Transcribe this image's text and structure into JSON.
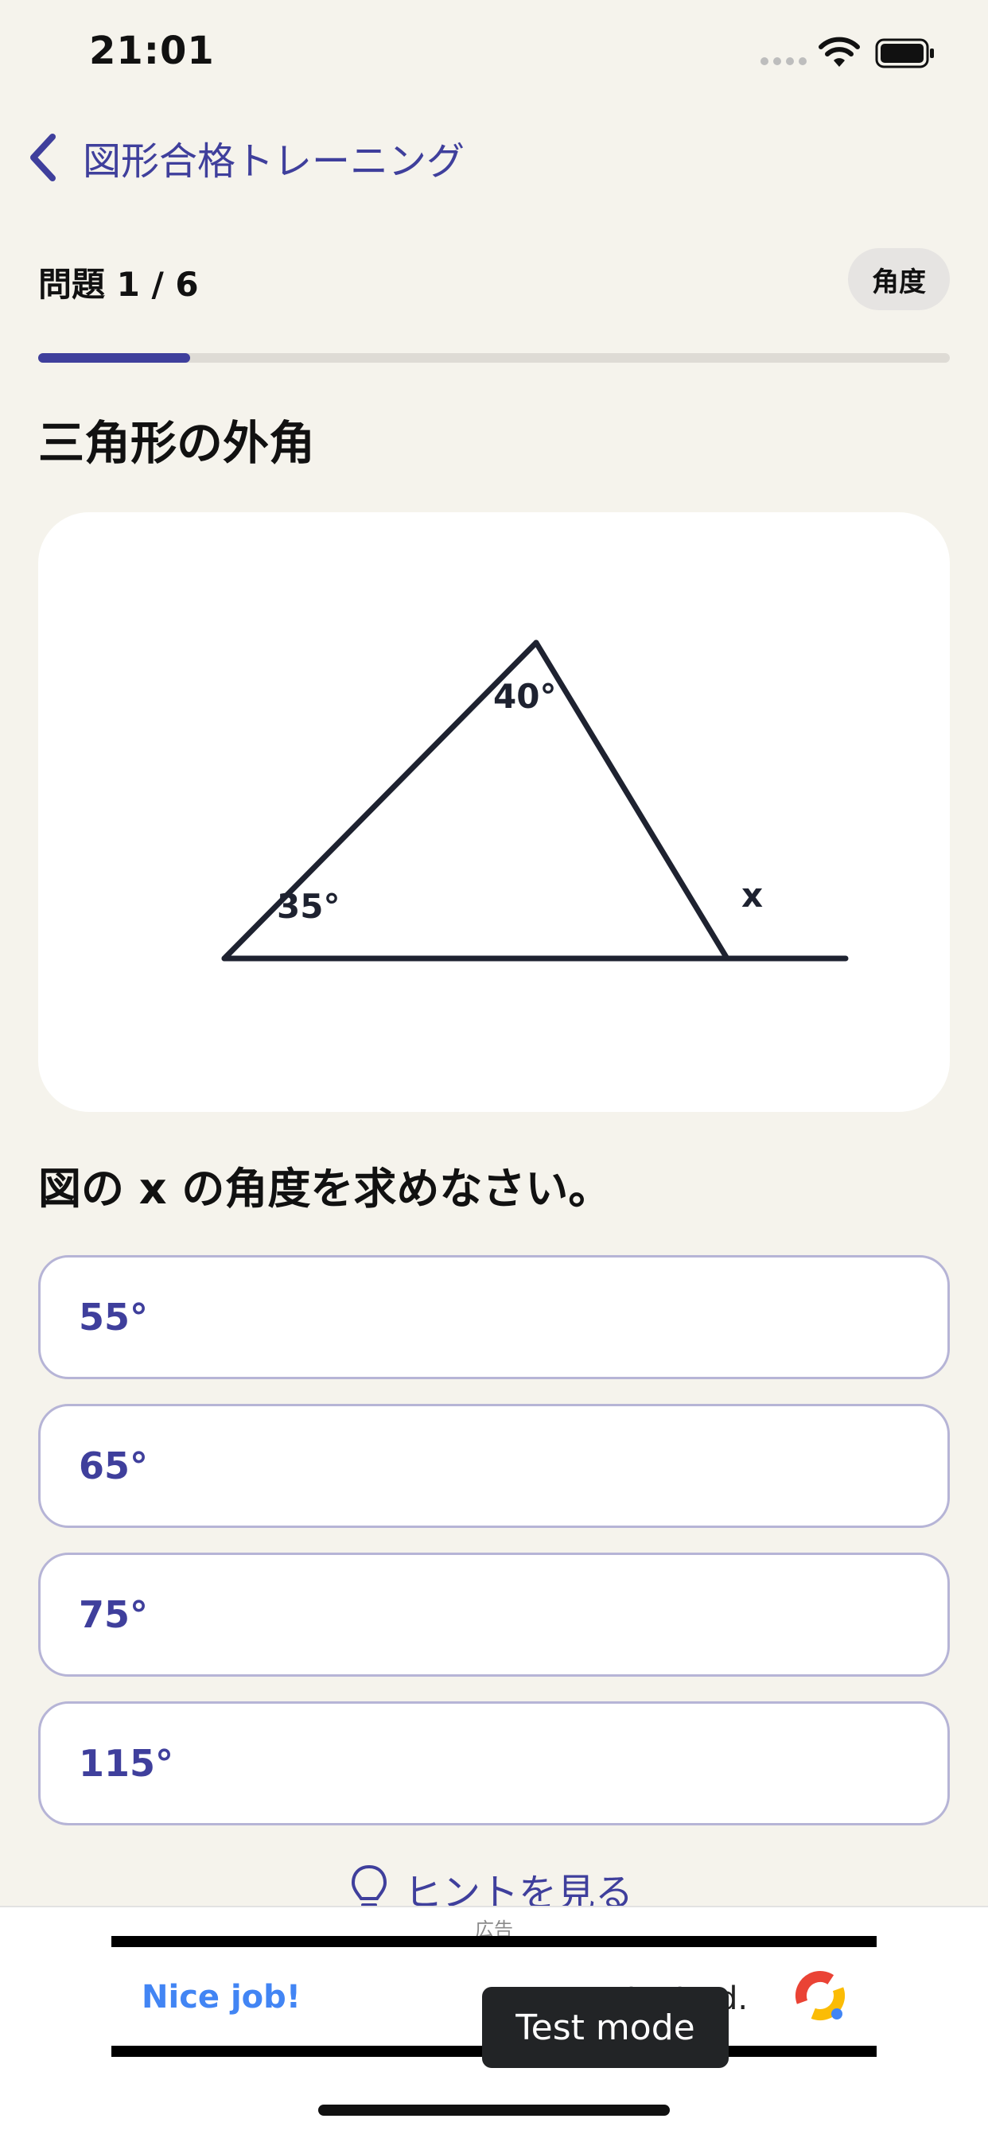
{
  "status_bar": {
    "time": "21:01"
  },
  "nav": {
    "back_title": "図形合格トレーニング"
  },
  "quiz": {
    "counter": "問題 1 / 6",
    "tag": "角度",
    "progress_fraction": 0.1667,
    "section_title": "三角形の外角",
    "figure": {
      "angle_top": "40°",
      "angle_left": "35°",
      "angle_unknown": "x"
    },
    "question": "図の x の角度を求めなさい。",
    "choices": [
      "55°",
      "65°",
      "75°",
      "115°"
    ],
    "hint_label": "ヒントを見る"
  },
  "ad": {
    "label": "広告",
    "nice_job": "Nice job!",
    "test_ad": "test ad.",
    "test_mode": "Test mode"
  },
  "colors": {
    "accent": "#3F3F9C",
    "background": "#F5F3EC",
    "choice_border": "#B6B4D6"
  }
}
